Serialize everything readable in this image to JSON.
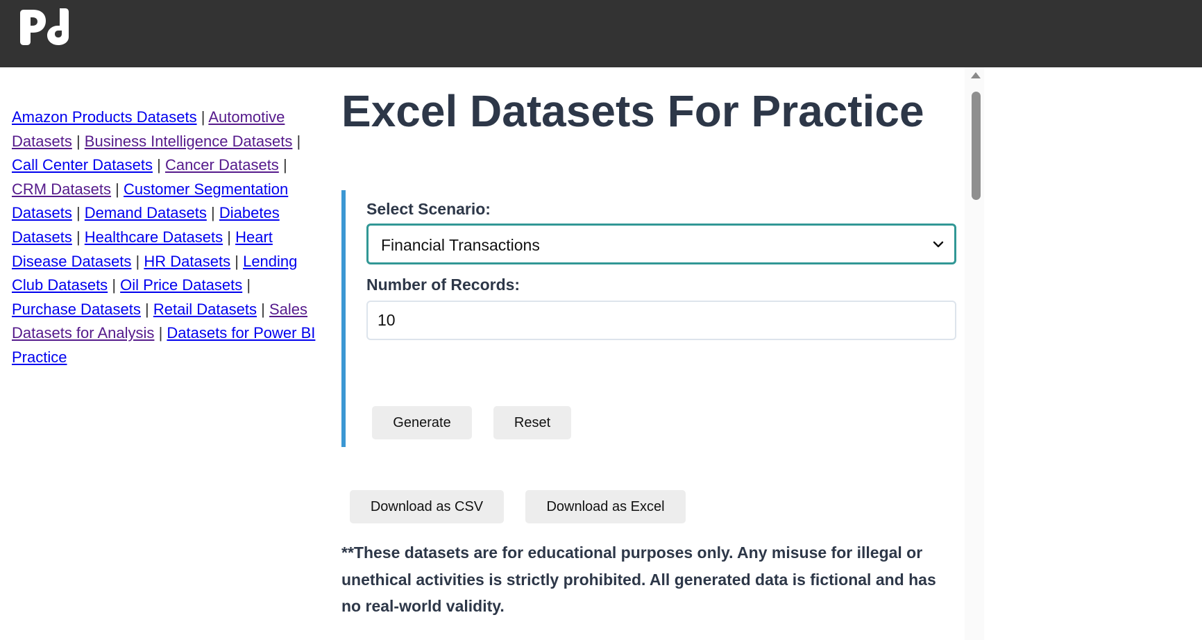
{
  "header": {
    "logo_text": "Pd"
  },
  "sidebar": {
    "links": [
      {
        "label": "Amazon Products Datasets",
        "visited": false
      },
      {
        "label": "Automotive Datasets",
        "visited": true
      },
      {
        "label": "Business Intelligence Datasets",
        "visited": true
      },
      {
        "label": "Call Center Datasets",
        "visited": false
      },
      {
        "label": "Cancer Datasets",
        "visited": true
      },
      {
        "label": "CRM Datasets",
        "visited": true
      },
      {
        "label": "Customer Segmentation Datasets",
        "visited": false
      },
      {
        "label": "Demand Datasets",
        "visited": false
      },
      {
        "label": "Diabetes Datasets",
        "visited": false
      },
      {
        "label": "Healthcare Datasets",
        "visited": false
      },
      {
        "label": "Heart Disease Datasets",
        "visited": false
      },
      {
        "label": "HR Datasets",
        "visited": false
      },
      {
        "label": "Lending Club Datasets",
        "visited": false
      },
      {
        "label": "Oil Price Datasets",
        "visited": false
      },
      {
        "label": "Purchase Datasets",
        "visited": false
      },
      {
        "label": "Retail Datasets",
        "visited": false
      },
      {
        "label": "Sales Datasets for Analysis",
        "visited": true
      },
      {
        "label": "Datasets for Power BI Practice",
        "visited": false
      }
    ],
    "separator": "|"
  },
  "main": {
    "title": "Excel Datasets For Practice",
    "form": {
      "scenario_label": "Select Scenario:",
      "scenario_value": "Financial Transactions",
      "records_label": "Number of Records:",
      "records_value": "10",
      "generate_label": "Generate",
      "reset_label": "Reset"
    },
    "download_csv_label": "Download as CSV",
    "download_excel_label": "Download as Excel",
    "disclaimer": "**These datasets are for educational purposes only. Any misuse for illegal or unethical activities is strictly prohibited. All generated data is fictional and has no real-world validity."
  },
  "colors": {
    "header_bg": "#333333",
    "accent_border": "#3b97d3",
    "select_border": "#319795",
    "title_text": "#2d3748",
    "link_visited": "#551a8b",
    "link_unvisited": "#0000ee"
  }
}
